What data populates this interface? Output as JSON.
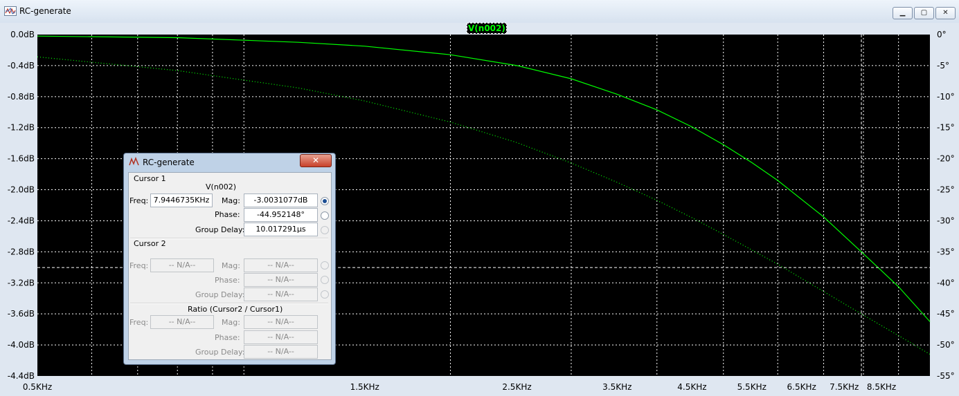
{
  "window": {
    "title": "RC-generate",
    "controls": {
      "minimize": "▁",
      "maximize": "▢",
      "close": "✕"
    }
  },
  "plot": {
    "trace_label": "V(n002)",
    "y_left_ticks": [
      "0.0dB",
      "-0.4dB",
      "-0.8dB",
      "-1.2dB",
      "-1.6dB",
      "-2.0dB",
      "-2.4dB",
      "-2.8dB",
      "-3.2dB",
      "-3.6dB",
      "-4.0dB",
      "-4.4dB"
    ],
    "y_right_ticks": [
      "0°",
      "-5°",
      "-10°",
      "-15°",
      "-20°",
      "-25°",
      "-30°",
      "-35°",
      "-40°",
      "-45°",
      "-50°",
      "-55°"
    ],
    "x_ticks": [
      "0.5KHz",
      "1.5KHz",
      "2.5KHz",
      "3.5KHz",
      "4.5KHz",
      "5.5KHz",
      "6.5KHz",
      "7.5KHz",
      "8.5KHz"
    ],
    "colors": {
      "background": "#000000",
      "trace": "#00ff00",
      "grid": "#ffffff"
    }
  },
  "chart_data": {
    "type": "line",
    "x_scale": "log",
    "xlim": [
      500,
      10000
    ],
    "ylim_left": [
      -4.4,
      0.0
    ],
    "ylim_right": [
      -55,
      0
    ],
    "xlabel": "",
    "ylabel": "",
    "series": [
      {
        "axis": "left",
        "style": "solid",
        "x": [
          500,
          800,
          1200,
          1500,
          2000,
          2500,
          3000,
          3500,
          4000,
          4500,
          5000,
          5500,
          6000,
          7000,
          7945,
          9000,
          10000
        ],
        "y": [
          -0.02,
          -0.04,
          -0.1,
          -0.15,
          -0.26,
          -0.4,
          -0.57,
          -0.77,
          -0.97,
          -1.19,
          -1.42,
          -1.65,
          -1.88,
          -2.35,
          -2.8,
          -3.25,
          -3.7
        ]
      },
      {
        "axis": "right",
        "style": "dotted",
        "x": [
          500,
          800,
          1200,
          1500,
          2000,
          2500,
          3000,
          3500,
          4000,
          4500,
          5000,
          5500,
          6000,
          7000,
          7945,
          9000,
          10000
        ],
        "y": [
          -3.6,
          -5.8,
          -8.6,
          -10.7,
          -14.1,
          -17.4,
          -20.7,
          -23.8,
          -26.7,
          -29.5,
          -32.2,
          -34.7,
          -37.0,
          -41.4,
          -45.0,
          -48.5,
          -51.5
        ]
      }
    ],
    "cursor": {
      "x": 7944.6735,
      "y": -3.0031077
    }
  },
  "dialog": {
    "title": "RC-generate",
    "close": "✕",
    "cursor1": {
      "header": "Cursor 1",
      "trace": "V(n002)",
      "freq_label": "Freq:",
      "freq_value": "7.9446735KHz",
      "mag_label": "Mag:",
      "mag_value": "-3.0031077dB",
      "phase_label": "Phase:",
      "phase_value": "-44.952148°",
      "gd_label": "Group Delay:",
      "gd_value": "10.017291µs"
    },
    "cursor2": {
      "header": "Cursor 2",
      "freq_label": "Freq:",
      "freq_value": "-- N/A--",
      "mag_label": "Mag:",
      "mag_value": "-- N/A--",
      "phase_label": "Phase:",
      "phase_value": "-- N/A--",
      "gd_label": "Group Delay:",
      "gd_value": "-- N/A--"
    },
    "ratio": {
      "header": "Ratio (Cursor2 / Cursor1)",
      "freq_label": "Freq:",
      "freq_value": "-- N/A--",
      "mag_label": "Mag:",
      "mag_value": "-- N/A--",
      "phase_label": "Phase:",
      "phase_value": "-- N/A--",
      "gd_label": "Group Delay:",
      "gd_value": "-- N/A--"
    }
  }
}
